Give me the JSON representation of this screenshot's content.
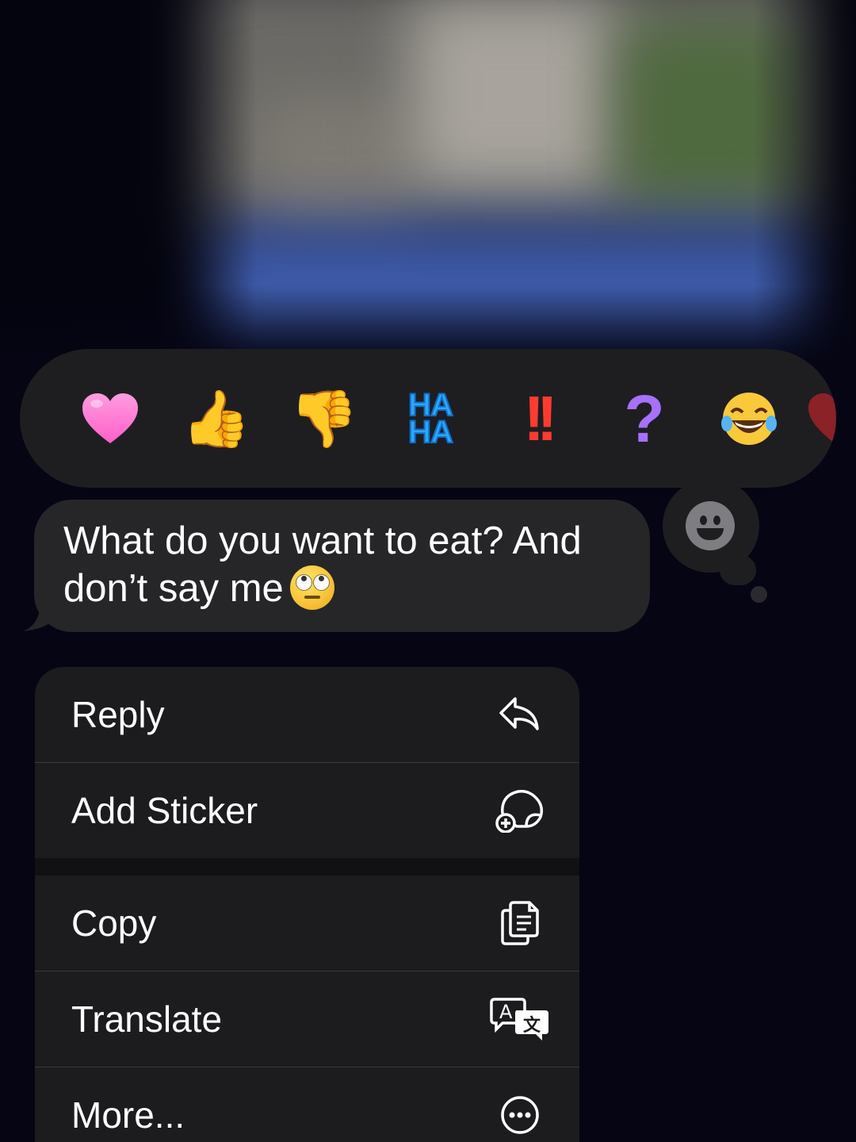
{
  "message": {
    "text": "What do you want to eat? And don’t say me"
  },
  "reactions": [
    {
      "name": "heart",
      "glyph": "❤"
    },
    {
      "name": "thumbs-up",
      "glyph": "👍"
    },
    {
      "name": "thumbs-down",
      "glyph": "👎"
    },
    {
      "name": "haha",
      "line1": "HA",
      "line2": "HA"
    },
    {
      "name": "exclamation",
      "glyph": "!!"
    },
    {
      "name": "question",
      "glyph": "?"
    },
    {
      "name": "laughing",
      "glyph": "😂"
    },
    {
      "name": "more-emoji",
      "glyph": "❤"
    }
  ],
  "menu": {
    "reply": "Reply",
    "add_sticker": "Add Sticker",
    "copy": "Copy",
    "translate": "Translate",
    "more": "More..."
  },
  "icons": {
    "reply": "reply-arrow-icon",
    "add_sticker": "add-sticker-icon",
    "copy": "copy-icon",
    "translate": "translate-icon",
    "more": "more-ellipsis-icon",
    "emoji_picker": "smiley-face-icon"
  },
  "colors": {
    "background": "#050514",
    "surface": "#1e1e21",
    "bubble": "#262629",
    "menu": "#1c1c1e",
    "text": "#ffffff"
  }
}
